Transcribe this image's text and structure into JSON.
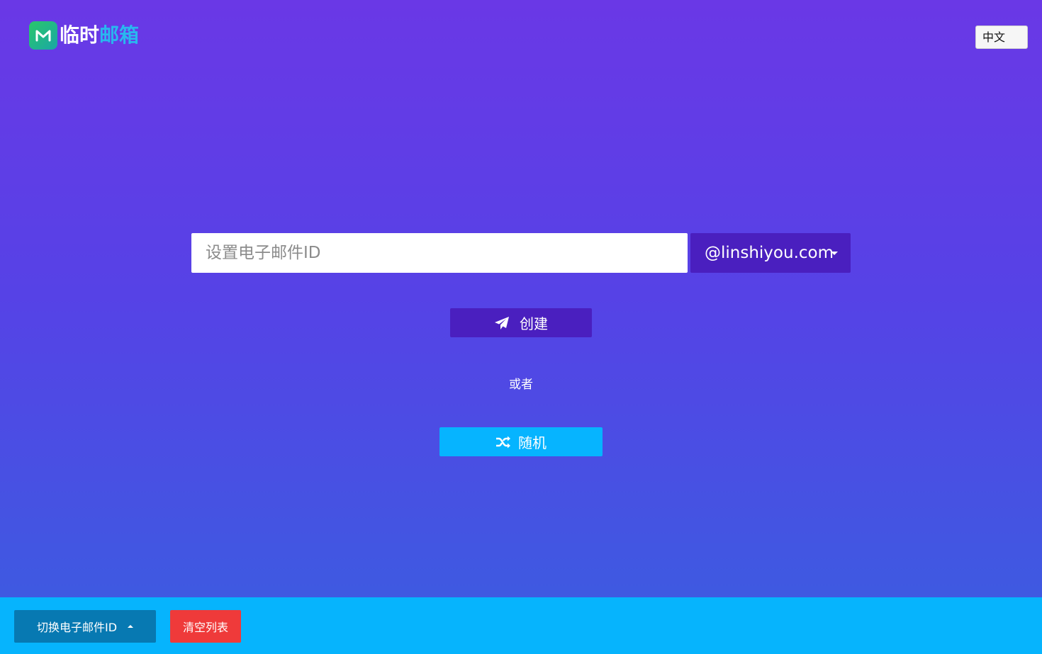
{
  "logo": {
    "icon": "mail-m-icon",
    "text_white": "临时",
    "text_blue": "邮箱"
  },
  "language": {
    "selected": "中文"
  },
  "email_form": {
    "placeholder": "设置电子邮件ID",
    "value": "",
    "domain": "@linshiyou.com"
  },
  "actions": {
    "create_label": "创建",
    "create_icon": "paper-plane-icon",
    "or_text": "或者",
    "random_label": "随机",
    "random_icon": "shuffle-icon"
  },
  "footer": {
    "switch_label": "切换电子邮件ID",
    "clear_label": "清空列表"
  },
  "colors": {
    "background_top": "#6a38e6",
    "background_bottom": "#3a5ee0",
    "primary_button": "#4a1fbf",
    "random_button": "#06b4ff",
    "footer_bar": "#06b4fd",
    "switch_button": "#0779b2",
    "clear_button": "#ef3a3a"
  }
}
